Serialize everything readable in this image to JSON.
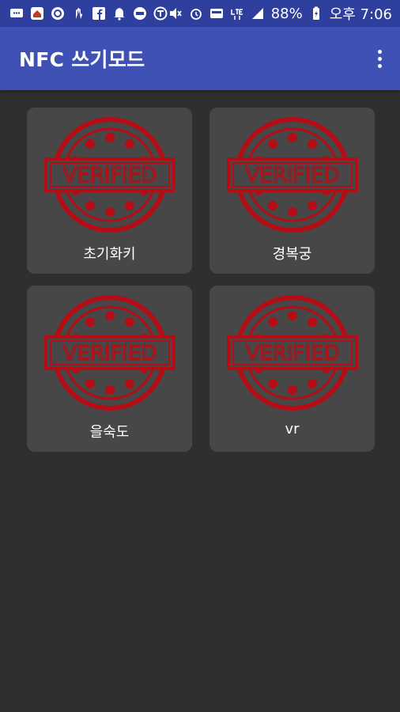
{
  "status": {
    "battery": "88%",
    "time": "오후 7:06"
  },
  "appbar": {
    "title": "NFC 쓰기모드"
  },
  "cards": [
    {
      "label": "초기화키",
      "stamp_text": "VERIFIED"
    },
    {
      "label": "경복궁",
      "stamp_text": "VERIFIED"
    },
    {
      "label": "을숙도",
      "stamp_text": "VERIFIED"
    },
    {
      "label": "vr",
      "stamp_text": "VERIFIED"
    }
  ],
  "colors": {
    "status_bar": "#2f3f9e",
    "app_bar": "#3f51b5",
    "background": "#2f2f2f",
    "card": "#474747",
    "stamp": "#b40d15"
  }
}
